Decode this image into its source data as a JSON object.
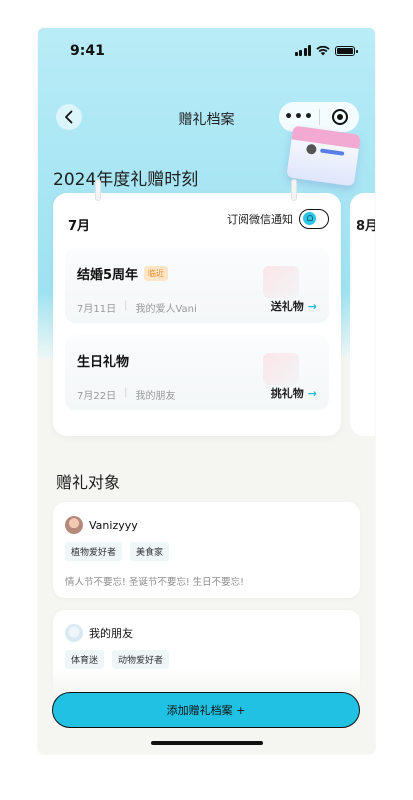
{
  "status_bar": {
    "time": "9:41"
  },
  "nav": {
    "title": "赠礼档案",
    "more_label": "•••"
  },
  "hero": {
    "title": "2024年度礼赠时刻"
  },
  "month_card": {
    "month": "7月",
    "subscribe_label": "订阅微信通知",
    "subscribe_on": true,
    "events": [
      {
        "name": "结婚5周年",
        "tag": "临近",
        "date": "7月11日",
        "recipient": "我的爱人Vani",
        "action": "送礼物"
      },
      {
        "name": "生日礼物",
        "tag": "",
        "date": "7月22日",
        "recipient": "我的朋友",
        "action": "挑礼物"
      }
    ]
  },
  "next_card": {
    "month": "8月"
  },
  "recipients": {
    "title": "赠礼对象",
    "items": [
      {
        "name": "Vanizyyy",
        "tags": [
          "植物爱好者",
          "美食家"
        ],
        "note": "情人节不要忘! 圣诞节不要忘! 生日不要忘!"
      },
      {
        "name": "我的朋友",
        "tags": [
          "体育迷",
          "动物爱好者"
        ],
        "note": ""
      }
    ]
  },
  "add_button": {
    "label": "添加赠礼档案 +"
  },
  "colors": {
    "accent": "#20c1e2",
    "hero_bg": "#a9e6f4",
    "tag_orange": "#f08c2a"
  }
}
